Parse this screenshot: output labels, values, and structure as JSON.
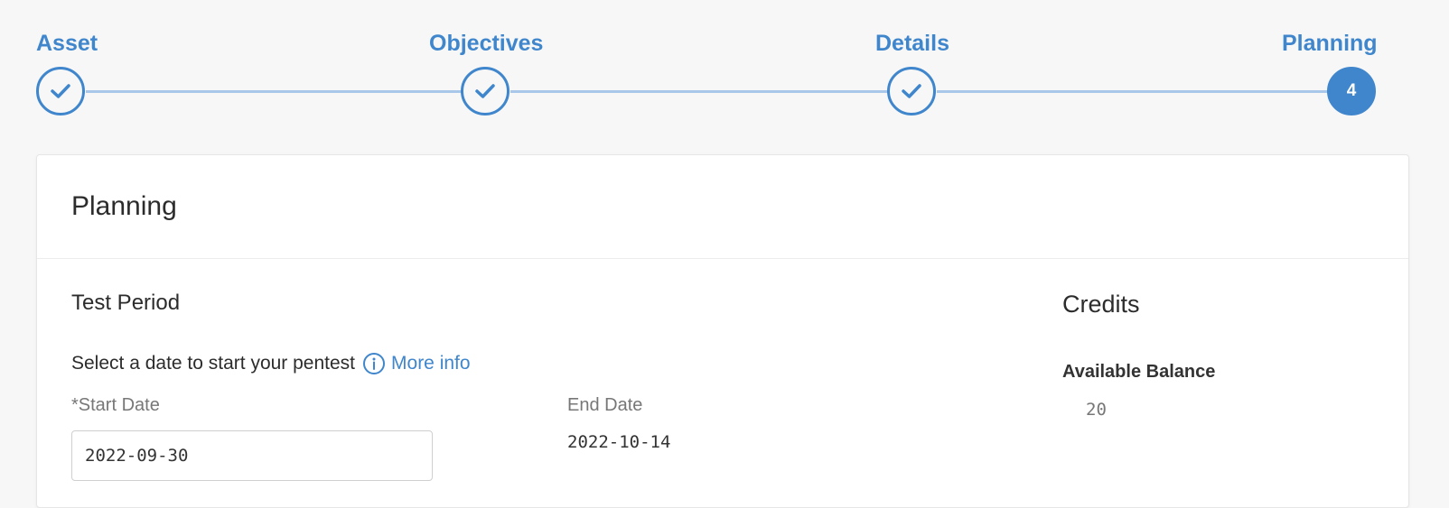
{
  "stepper": {
    "steps": [
      {
        "label": "Asset",
        "state": "completed"
      },
      {
        "label": "Objectives",
        "state": "completed"
      },
      {
        "label": "Details",
        "state": "completed"
      },
      {
        "label": "Planning",
        "state": "active",
        "number": "4"
      }
    ]
  },
  "card": {
    "title": "Planning",
    "test_period": {
      "title": "Test Period",
      "description": "Select a date to start your pentest",
      "more_info": "More info",
      "start_date": {
        "label": "*Start Date",
        "value": "2022-09-30"
      },
      "end_date": {
        "label": "End Date",
        "value": "2022-10-14"
      }
    },
    "credits": {
      "title": "Credits",
      "balance_label": "Available Balance",
      "balance_value": "20"
    }
  },
  "colors": {
    "accent": "#3f86cc",
    "connector": "#a9c7e8",
    "background": "#f7f7f7"
  }
}
